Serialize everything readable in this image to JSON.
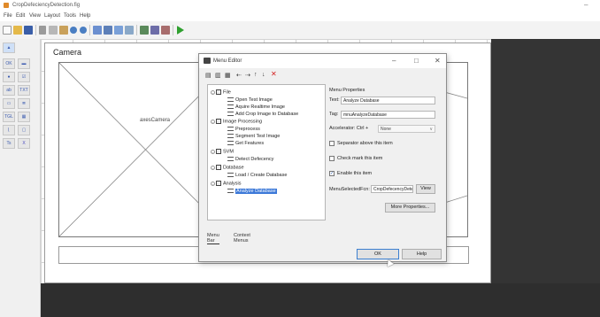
{
  "window": {
    "title": "CropDefeciencyDetection.fig"
  },
  "menubar": {
    "items": [
      "File",
      "Edit",
      "View",
      "Layout",
      "Tools",
      "Help"
    ]
  },
  "toolbar": {
    "icons": [
      "new-icon",
      "open-icon",
      "save-icon",
      "cut-icon",
      "copy-icon",
      "paste-icon",
      "undo-icon",
      "redo-icon",
      "align-icon",
      "menu-editor-icon",
      "tab-order-icon",
      "toolbar-editor-icon",
      "editor-icon",
      "property-inspector-icon",
      "object-browser-icon",
      "run-icon"
    ]
  },
  "palette": {
    "tools": [
      "select",
      "pushbutton",
      "slider",
      "radiobutton",
      "checkbox",
      "edit",
      "text",
      "popupmenu",
      "listbox",
      "togglebutton",
      "table",
      "axes",
      "panel",
      "buttongroup",
      "activex"
    ]
  },
  "figure": {
    "panel_title": "Camera",
    "axes_label": "axesCamera"
  },
  "menu_editor": {
    "title": "Menu Editor",
    "window_controls": {
      "minimize": "–",
      "maximize": "□",
      "close": "✕"
    },
    "toolbar": [
      "new-menu-icon",
      "new-context-menu-icon",
      "move-left-icon",
      "move-right-icon",
      "move-up-icon",
      "move-down-icon",
      "delete-icon"
    ],
    "tree": [
      {
        "label": "File",
        "level": 0,
        "type": "menu"
      },
      {
        "label": "Open Test Image",
        "level": 1,
        "type": "item"
      },
      {
        "label": "Aquire Realtime Image",
        "level": 1,
        "type": "item"
      },
      {
        "label": "Add Crop Image to Database",
        "level": 1,
        "type": "item"
      },
      {
        "label": "Image Processing",
        "level": 0,
        "type": "menu"
      },
      {
        "label": "Preprocess",
        "level": 1,
        "type": "item"
      },
      {
        "label": "Segment Test Image",
        "level": 1,
        "type": "item"
      },
      {
        "label": "Get Features",
        "level": 1,
        "type": "item"
      },
      {
        "label": "SVM",
        "level": 0,
        "type": "menu"
      },
      {
        "label": "Detect Defecency",
        "level": 1,
        "type": "item"
      },
      {
        "label": "Database",
        "level": 0,
        "type": "menu"
      },
      {
        "label": "Load / Create Database",
        "level": 1,
        "type": "item"
      },
      {
        "label": "Analysis",
        "level": 0,
        "type": "menu"
      },
      {
        "label": "Analyze Database",
        "level": 1,
        "type": "item",
        "selected": true
      }
    ],
    "tabs": {
      "menu_bar": "Menu Bar",
      "context_menus": "Context Menus"
    },
    "properties": {
      "header": "Menu Properties",
      "text_label": "Text:",
      "text_value": "Analyze Database",
      "tag_label": "Tag:",
      "tag_value": "mnuAnalyzeDatabase",
      "accelerator_label": "Accelerator: Ctrl +",
      "accelerator_value": "None",
      "separator_label": "Separator above this item",
      "separator_checked": false,
      "check_mark_label": "Check mark this item",
      "check_mark_checked": false,
      "enable_label": "Enable this item",
      "enable_checked": true,
      "callback_label": "MenuSelectedFcn:",
      "callback_value": "CropDefecencyDetection('mnuAnalyzeDatabase_Callback',hObject,eventdata,guidata(hObject))",
      "view_button": "View",
      "more_button": "More Properties..."
    },
    "buttons": {
      "ok": "OK",
      "help": "Help"
    }
  }
}
